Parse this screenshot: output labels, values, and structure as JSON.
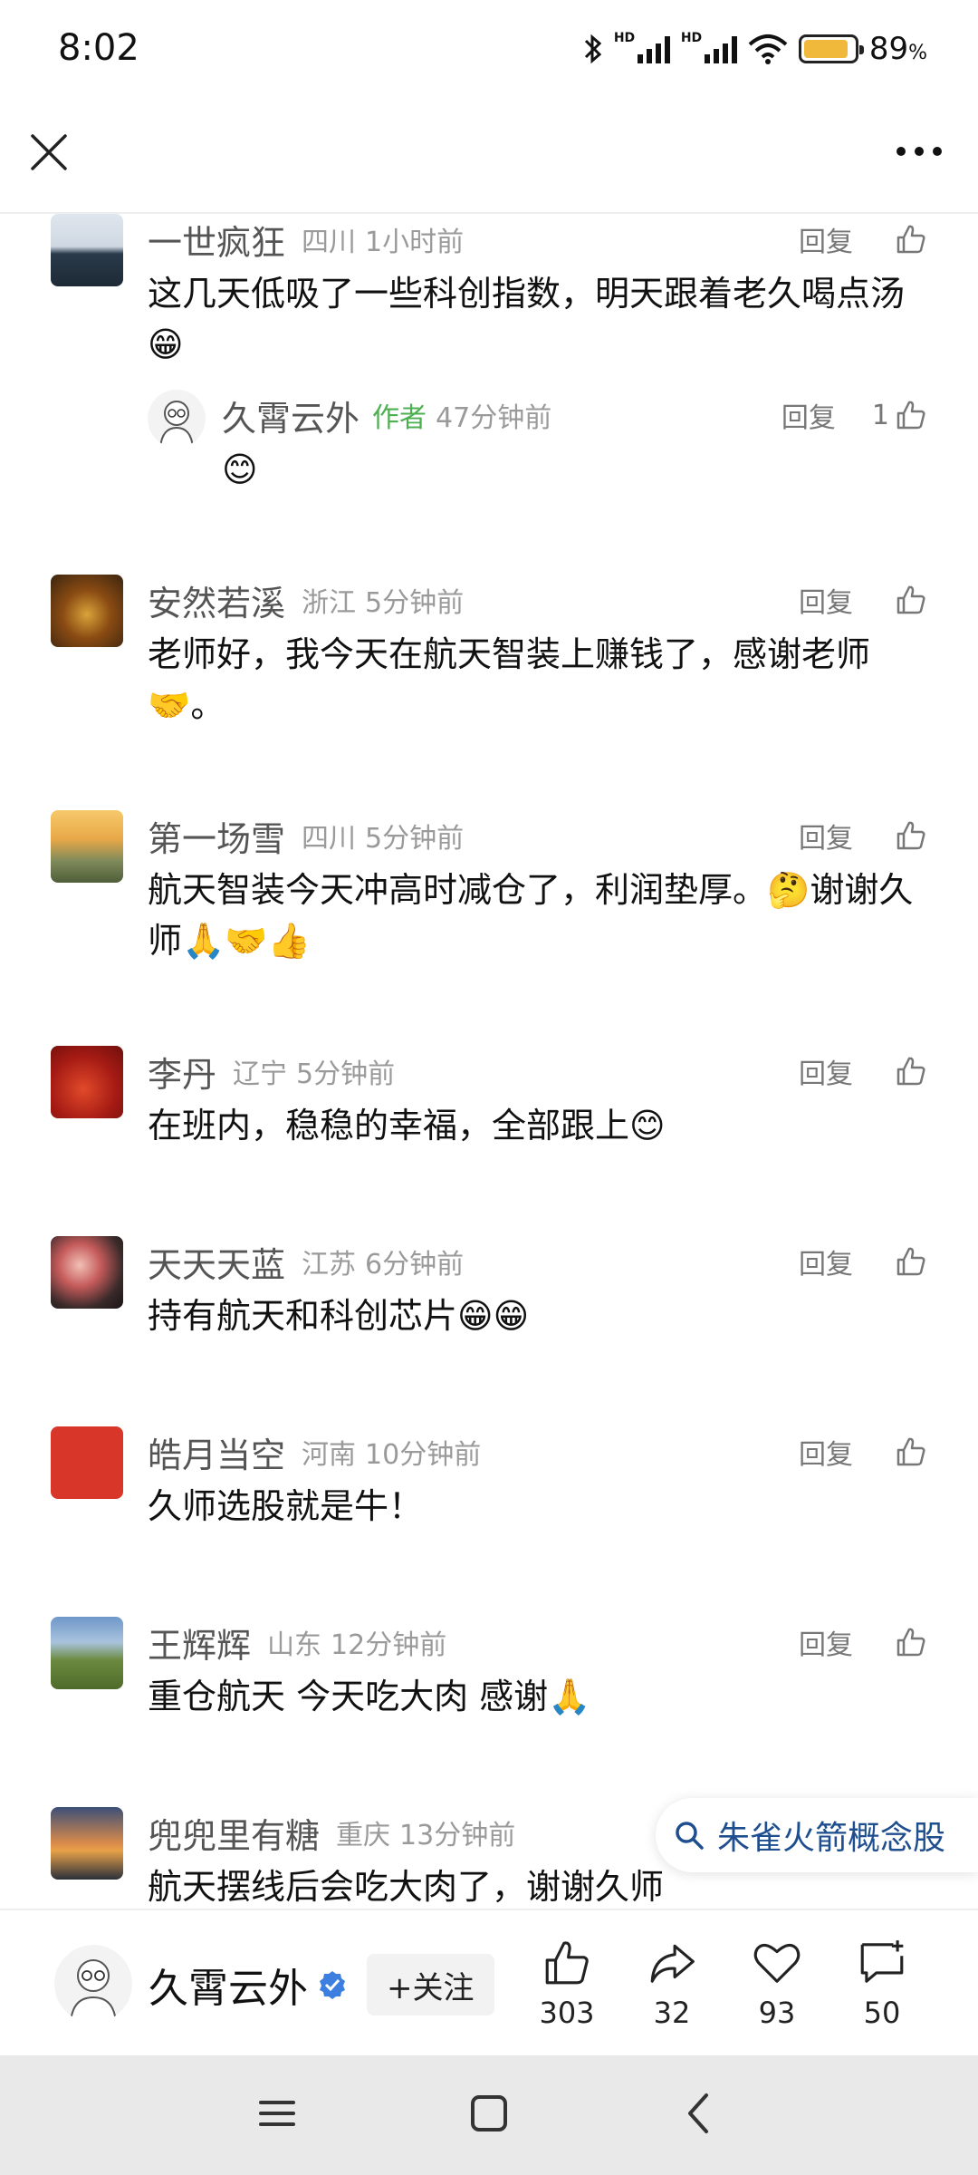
{
  "status_bar": {
    "time": "8:02",
    "battery_pct": "89",
    "pct_sign": "%",
    "hd1": "HD",
    "hd2": "HD",
    "battery_level": 0.89
  },
  "comments": [
    {
      "user": "一世疯狂",
      "region": "四川",
      "time": "1小时前",
      "reply": "回复",
      "likes": "",
      "text": "这几天低吸了一些科创指数，明天跟着老久喝点汤😁",
      "sub": {
        "user": "久霄云外",
        "tag": "作者",
        "time": "47分钟前",
        "reply": "回复",
        "likes": "1",
        "text": "😊"
      }
    },
    {
      "user": "安然若溪",
      "region": "浙江",
      "time": "5分钟前",
      "reply": "回复",
      "likes": "",
      "text": "老师好，我今天在航天智装上赚钱了，感谢老师🤝。"
    },
    {
      "user": "第一场雪",
      "region": "四川",
      "time": "5分钟前",
      "reply": "回复",
      "likes": "",
      "text": "航天智装今天冲高时减仓了，利润垫厚。🤔谢谢久师🙏🤝👍"
    },
    {
      "user": "李丹",
      "region": "辽宁",
      "time": "5分钟前",
      "reply": "回复",
      "likes": "",
      "text": "在班内，稳稳的幸福，全部跟上😊"
    },
    {
      "user": "天天天蓝",
      "region": "江苏",
      "time": "6分钟前",
      "reply": "回复",
      "likes": "",
      "text": "持有航天和科创芯片😁😁"
    },
    {
      "user": "皓月当空",
      "region": "河南",
      "time": "10分钟前",
      "reply": "回复",
      "likes": "",
      "text": "久师选股就是牛！"
    },
    {
      "user": "王辉辉",
      "region": "山东",
      "time": "12分钟前",
      "reply": "回复",
      "likes": "",
      "text": "重仓航天 今天吃大肉 感谢🙏"
    },
    {
      "user": "兜兜里有糖",
      "region": "重庆",
      "time": "13分钟前",
      "reply": "回复",
      "likes": "",
      "text": "航天摆线后会吃大肉了，谢谢久师"
    }
  ],
  "search_chip": {
    "text": "朱雀火箭概念股"
  },
  "footer": {
    "author": "久霄云外",
    "follow_label": "+关注",
    "likes": "303",
    "shares": "32",
    "favorites": "93",
    "comments": "50"
  },
  "colors": {
    "author_tag": "#4caf50",
    "search_text": "#1f4e8f",
    "verified": "#3d7fe0",
    "battery": "#f0b93b"
  }
}
